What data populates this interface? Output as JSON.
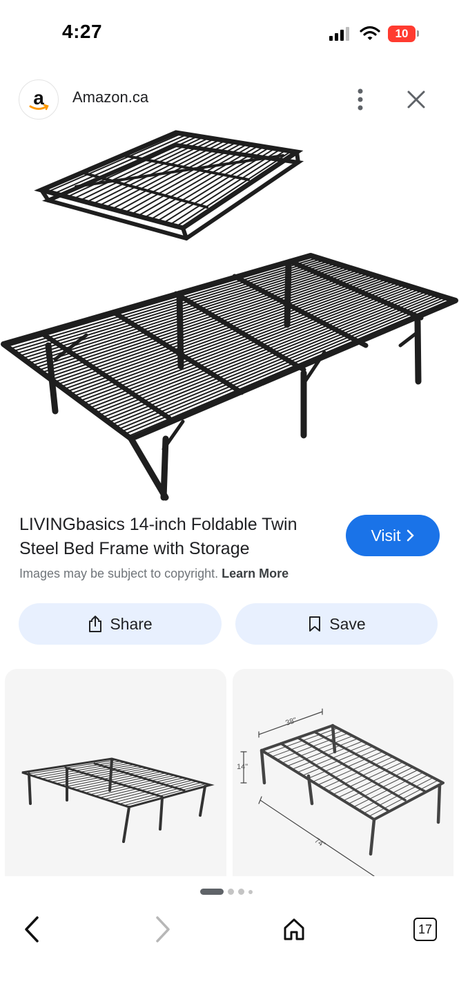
{
  "status_bar": {
    "time": "4:27",
    "battery_level": "10"
  },
  "header": {
    "source_name": "Amazon.ca",
    "logo_letter": "a"
  },
  "hero_image": {
    "alt": "LIVINGbasics folding steel bed frame, folded and unfolded"
  },
  "product": {
    "title": "LIVINGbasics 14-inch Foldable Twin Steel Bed Frame with Storage",
    "visit_label": "Visit",
    "copyright_text": "Images may be subject to copyright.",
    "learn_more_label": "Learn More"
  },
  "actions": {
    "share_label": "Share",
    "save_label": "Save"
  },
  "related": {
    "dimension_labels": {
      "width": "38\"",
      "height": "14\"",
      "length": "74\""
    }
  },
  "pager": {
    "pages": 4,
    "active_index": 0
  },
  "bottom_nav": {
    "tab_count": "17"
  },
  "colors": {
    "accent": "#1a73e8",
    "pill_background": "#e8f0fe",
    "battery_low": "#ff3b30"
  }
}
